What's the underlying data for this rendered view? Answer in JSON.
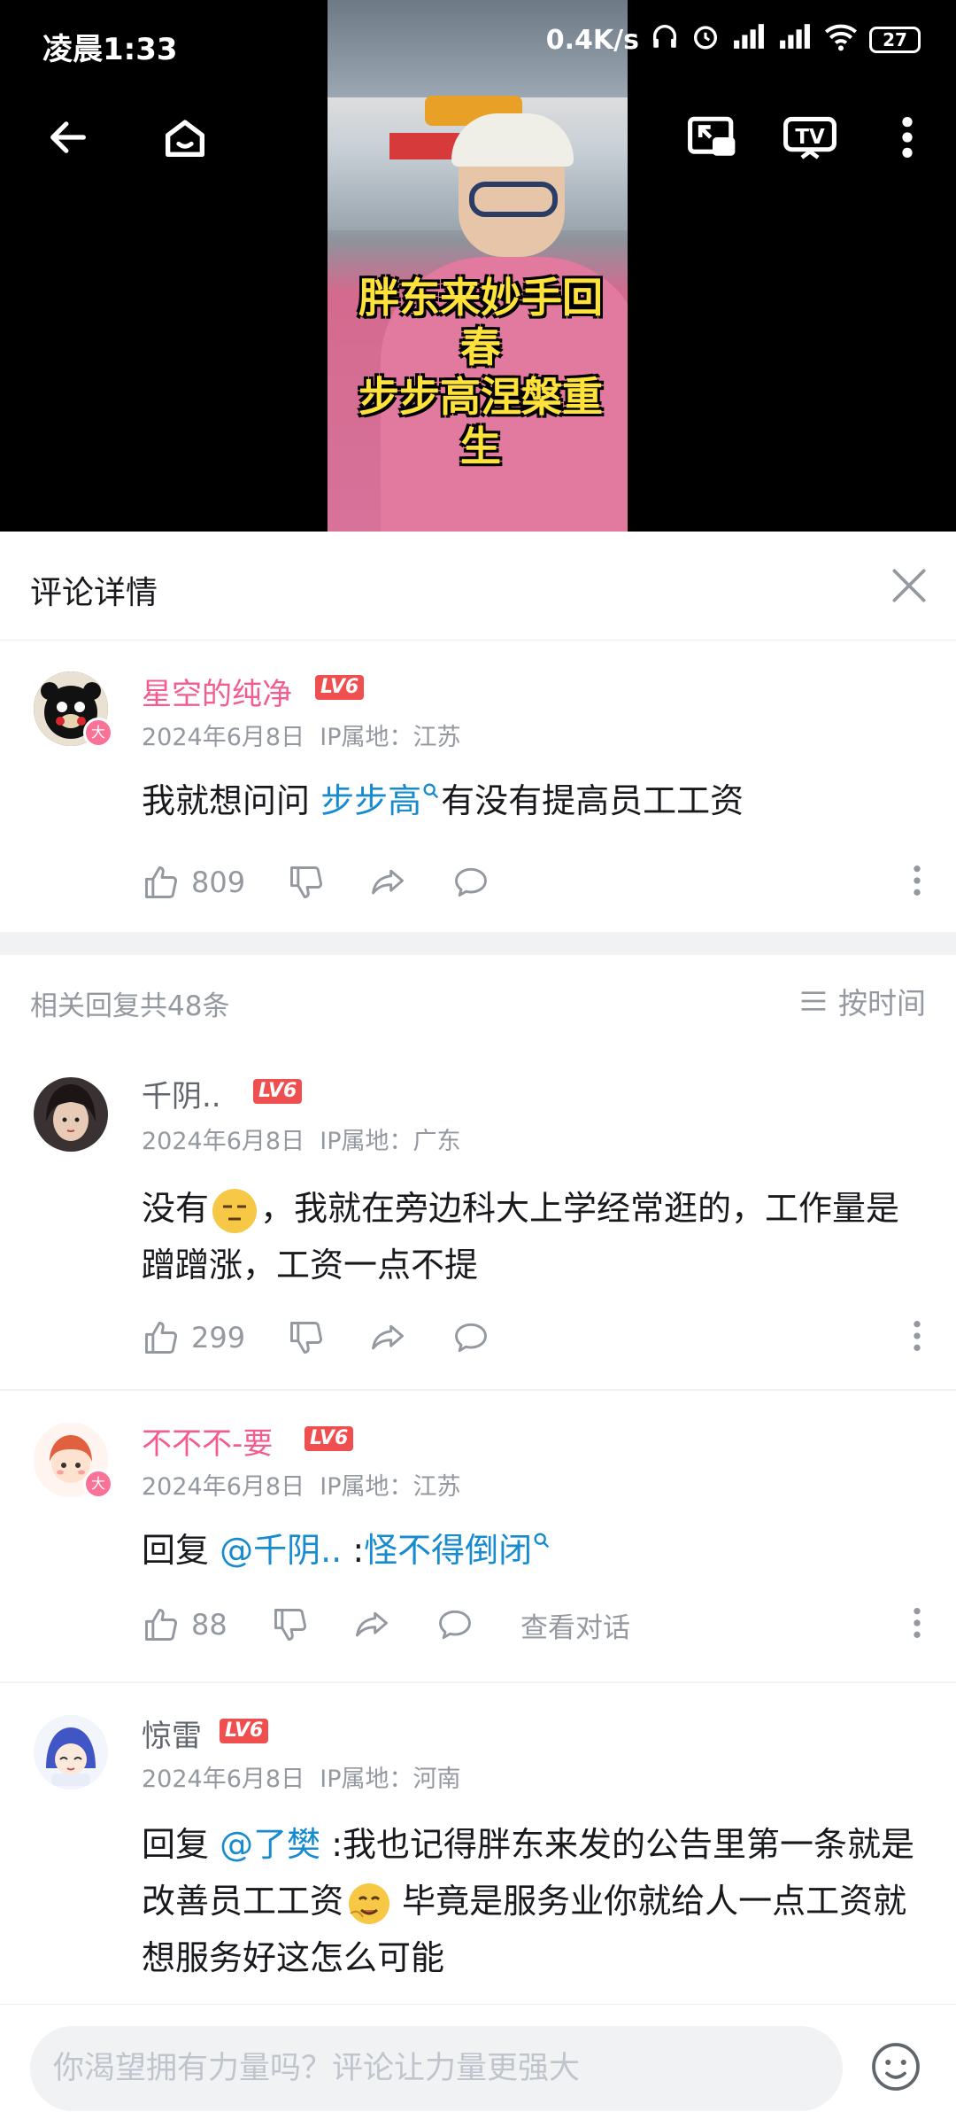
{
  "status_bar": {
    "time": "凌晨1:33",
    "network_speed": "0.4K/s",
    "battery": "27"
  },
  "video": {
    "caption_line1": "胖东来妙手回春",
    "caption_line2": "步步高涅槃重生"
  },
  "panel": {
    "title": "评论详情"
  },
  "main_comment": {
    "username": "星空的纯净",
    "level": "LV6",
    "date": "2024年6月8日",
    "ip": "IP属地：江苏",
    "text_before": "我就想问问 ",
    "link": "步步高",
    "text_after": "有没有提高员工工资",
    "likes": "809",
    "avatar_badge": "大"
  },
  "replies_header": {
    "count_label": "相关回复共48条",
    "sort_label": "按时间"
  },
  "replies": [
    {
      "username": "千阴..",
      "level": "LV6",
      "date": "2024年6月8日",
      "ip": "IP属地：广东",
      "text_before": "没有",
      "text_after": "，我就在旁边科大上学经常逛的，工作量是蹭蹭涨，工资一点不提",
      "likes": "299"
    },
    {
      "username": "不不不-要",
      "level": "LV6",
      "date": "2024年6月8日",
      "ip": "IP属地：江苏",
      "reply_prefix": "回复 ",
      "mention": "@千阴..",
      "text_colon": " :",
      "link": "怪不得倒闭",
      "likes": "88",
      "view_conversation": "查看对话",
      "avatar_badge": "大"
    },
    {
      "username": "惊雷",
      "level": "LV6",
      "date": "2024年6月8日",
      "ip": "IP属地：河南",
      "reply_prefix": "回复 ",
      "mention": "@了樊",
      "text_before": " :我也记得胖东来发的公告里第一条就是改善员工工资",
      "text_after": " 毕竟是服务业你就给人一点工资就想服务好这怎么可能"
    }
  ],
  "bottom_bar": {
    "placeholder": "你渴望拥有力量吗？评论让力量更强大"
  },
  "colors": {
    "pink_username": "#f25d8e",
    "link_blue": "#178bcf",
    "level_badge": "#f04f4f",
    "meta_grey": "#9499a0"
  }
}
